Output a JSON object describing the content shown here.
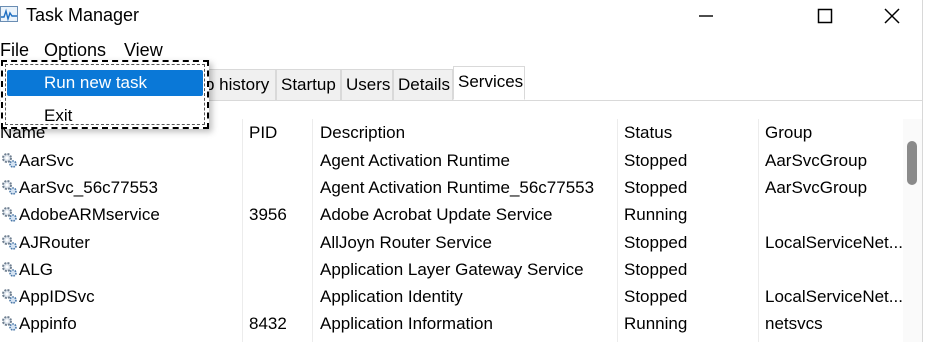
{
  "window": {
    "title": "Task Manager",
    "icon": "task-manager-icon"
  },
  "menubar": {
    "file": "File",
    "options": "Options",
    "view": "View"
  },
  "file_menu": {
    "items": [
      {
        "label": "Run new task",
        "selected": true
      },
      {
        "label": "Exit",
        "selected": false
      }
    ]
  },
  "tabs": [
    "p history",
    "Startup",
    "Users",
    "Details",
    "Services"
  ],
  "active_tab": "Services",
  "columns": {
    "name": "Name",
    "pid": "PID",
    "description": "Description",
    "status": "Status",
    "group": "Group"
  },
  "rows": [
    {
      "name": "AarSvc",
      "pid": "",
      "description": "Agent Activation Runtime",
      "status": "Stopped",
      "group": "AarSvcGroup"
    },
    {
      "name": "AarSvc_56c77553",
      "pid": "",
      "description": "Agent Activation Runtime_56c77553",
      "status": "Stopped",
      "group": "AarSvcGroup"
    },
    {
      "name": "AdobeARMservice",
      "pid": "3956",
      "description": "Adobe Acrobat Update Service",
      "status": "Running",
      "group": ""
    },
    {
      "name": "AJRouter",
      "pid": "",
      "description": "AllJoyn Router Service",
      "status": "Stopped",
      "group": "LocalServiceNet..."
    },
    {
      "name": "ALG",
      "pid": "",
      "description": "Application Layer Gateway Service",
      "status": "Stopped",
      "group": ""
    },
    {
      "name": "AppIDSvc",
      "pid": "",
      "description": "Application Identity",
      "status": "Stopped",
      "group": "LocalServiceNet..."
    },
    {
      "name": "Appinfo",
      "pid": "8432",
      "description": "Application Information",
      "status": "Running",
      "group": "netsvcs"
    }
  ],
  "colors": {
    "selection": "#0a78d7",
    "scroll_thumb": "#8a8a8a"
  }
}
